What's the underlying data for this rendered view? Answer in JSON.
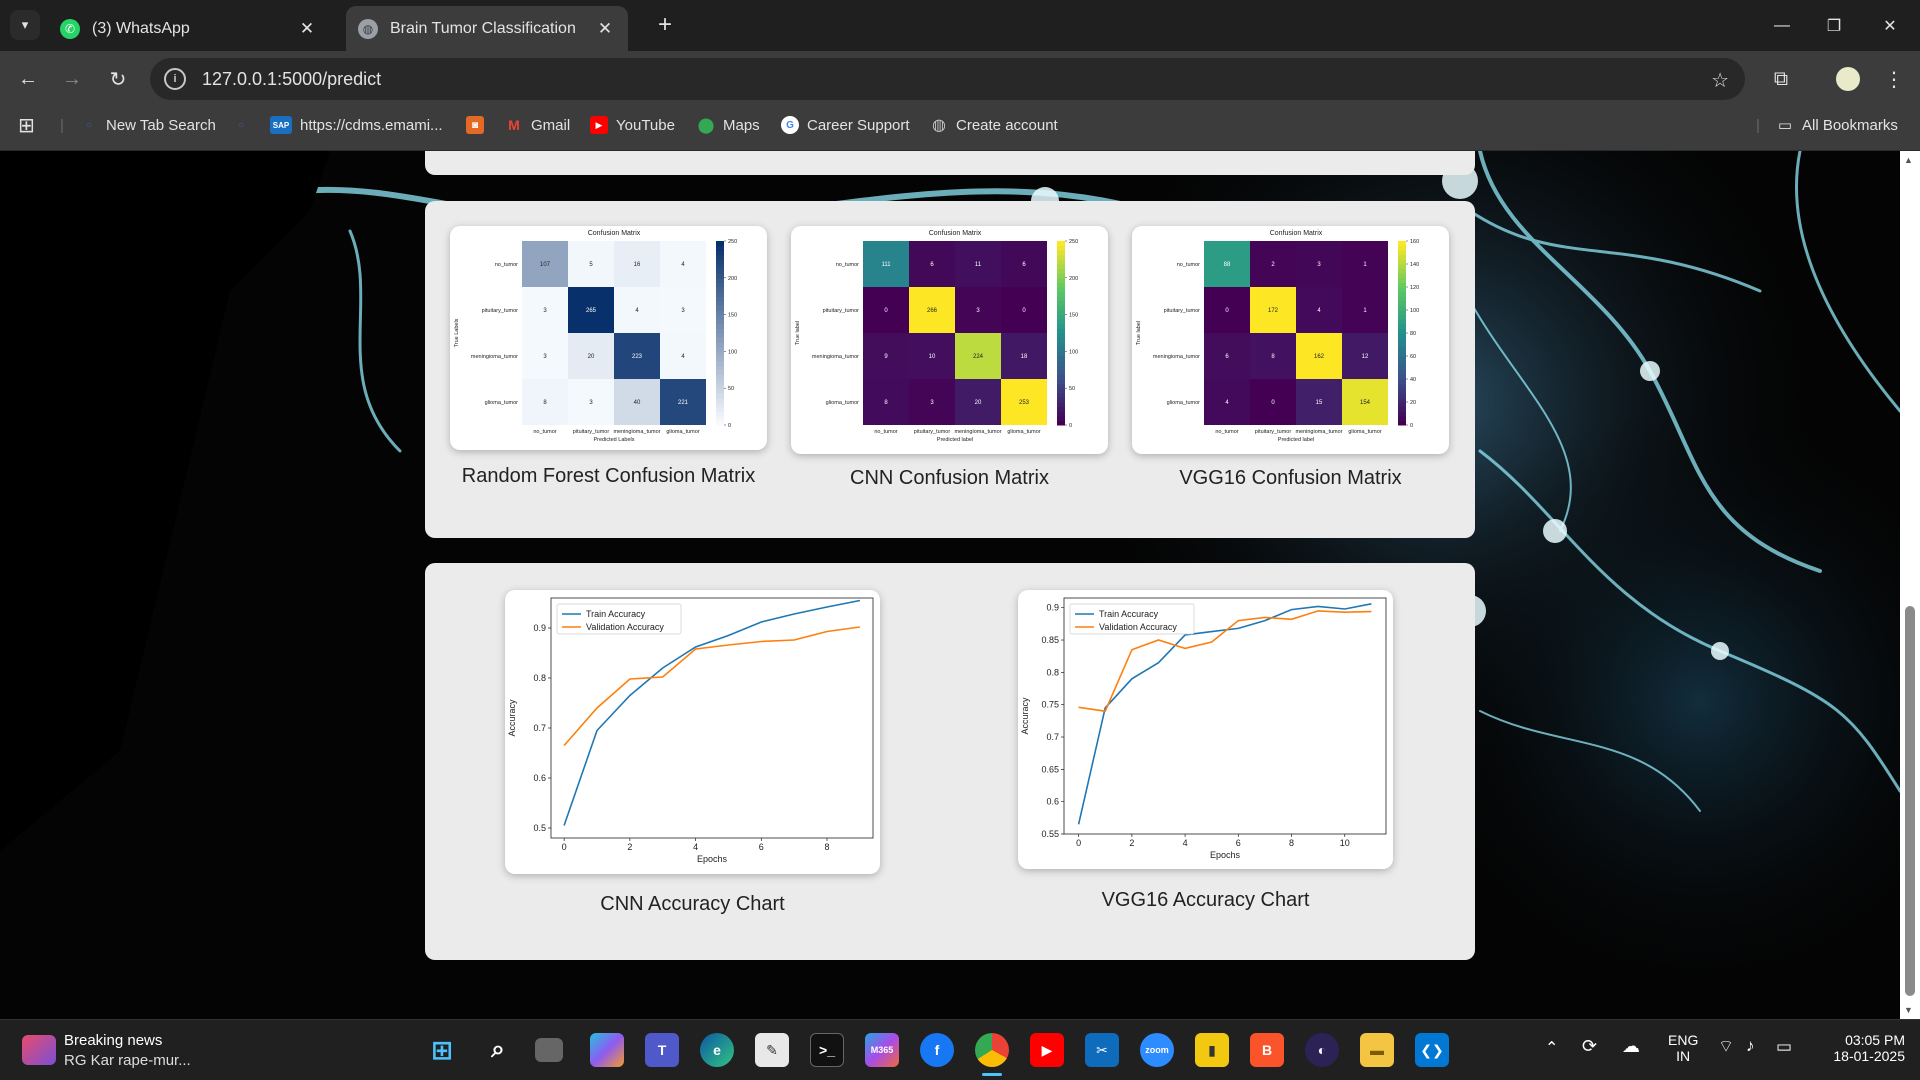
{
  "browser": {
    "tabs": [
      {
        "title": "(3) WhatsApp",
        "active": false,
        "icon": "whatsapp-icon"
      },
      {
        "title": "Brain Tumor Classification",
        "active": true,
        "icon": "globe-icon"
      }
    ],
    "url": "127.0.0.1:5000/predict",
    "bookmarks": [
      {
        "label": "New Tab Search",
        "icon": "search-icon"
      },
      {
        "label": "https://cdms.emami...",
        "icon": "sap-icon"
      },
      {
        "label": "",
        "icon": "bookmark-app-icon"
      },
      {
        "label": "Gmail",
        "icon": "gmail-icon"
      },
      {
        "label": "YouTube",
        "icon": "youtube-icon"
      },
      {
        "label": "Maps",
        "icon": "maps-icon"
      },
      {
        "label": "Career Support",
        "icon": "google-icon"
      },
      {
        "label": "Create account",
        "icon": "globe-icon"
      }
    ],
    "all_bookmarks": "All Bookmarks"
  },
  "page": {
    "confusion_captions": [
      "Random Forest Confusion Matrix",
      "CNN Confusion Matrix",
      "VGG16 Confusion Matrix"
    ],
    "accuracy_captions": [
      "CNN Accuracy Chart",
      "VGG16 Accuracy Chart"
    ]
  },
  "chart_data": [
    {
      "type": "heatmap",
      "title": "Confusion Matrix",
      "xlabel": "Predicted Labels",
      "ylabel": "True Labels",
      "labels": [
        "no_tumor",
        "pituitary_tumor",
        "meningioma_tumor",
        "glioma_tumor"
      ],
      "matrix": [
        [
          107,
          5,
          16,
          4
        ],
        [
          3,
          265,
          4,
          3
        ],
        [
          3,
          20,
          223,
          4
        ],
        [
          8,
          3,
          40,
          221
        ]
      ],
      "colorbar_ticks": [
        0,
        50,
        100,
        150,
        200,
        250
      ],
      "colormap": "Blues"
    },
    {
      "type": "heatmap",
      "title": "Confusion Matrix",
      "xlabel": "Predicted label",
      "ylabel": "True label",
      "labels": [
        "no_tumor",
        "pituitary_tumor",
        "meningioma_tumor",
        "glioma_tumor"
      ],
      "matrix": [
        [
          111,
          6,
          11,
          6
        ],
        [
          0,
          266,
          3,
          0
        ],
        [
          9,
          10,
          224,
          18
        ],
        [
          8,
          3,
          20,
          253
        ]
      ],
      "colorbar_ticks": [
        0,
        50,
        100,
        150,
        200,
        250
      ],
      "colormap": "viridis"
    },
    {
      "type": "heatmap",
      "title": "Confusion Matrix",
      "xlabel": "Predicted label",
      "ylabel": "True label",
      "labels": [
        "no_tumor",
        "pituitary_tumor",
        "meningioma_tumor",
        "glioma_tumor"
      ],
      "matrix": [
        [
          88,
          2,
          3,
          1
        ],
        [
          0,
          172,
          4,
          1
        ],
        [
          6,
          8,
          162,
          12
        ],
        [
          4,
          0,
          15,
          154
        ]
      ],
      "colorbar_ticks": [
        0,
        20,
        40,
        60,
        80,
        100,
        120,
        140,
        160
      ],
      "colormap": "viridis"
    },
    {
      "type": "line",
      "xlabel": "Epochs",
      "ylabel": "Accuracy",
      "xlim": [
        -0.4,
        9.4
      ],
      "ylim": [
        0.48,
        0.96
      ],
      "xticks": [
        0,
        2,
        4,
        6,
        8
      ],
      "yticks": [
        0.5,
        0.6,
        0.7,
        0.8,
        0.9
      ],
      "legend": "top-left",
      "series": [
        {
          "name": "Train Accuracy",
          "color": "#1f77b4",
          "x": [
            0,
            1,
            2,
            3,
            4,
            5,
            6,
            7,
            8,
            9
          ],
          "y": [
            0.505,
            0.695,
            0.765,
            0.82,
            0.862,
            0.885,
            0.912,
            0.928,
            0.942,
            0.955
          ]
        },
        {
          "name": "Validation Accuracy",
          "color": "#ff7f0e",
          "x": [
            0,
            1,
            2,
            3,
            4,
            5,
            6,
            7,
            8,
            9
          ],
          "y": [
            0.665,
            0.74,
            0.798,
            0.802,
            0.858,
            0.866,
            0.873,
            0.876,
            0.893,
            0.902
          ]
        }
      ]
    },
    {
      "type": "line",
      "xlabel": "Epochs",
      "ylabel": "Accuracy",
      "xlim": [
        -0.55,
        11.55
      ],
      "ylim": [
        0.55,
        0.915
      ],
      "xticks": [
        0,
        2,
        4,
        6,
        8,
        10
      ],
      "yticks": [
        0.55,
        0.6,
        0.65,
        0.7,
        0.75,
        0.8,
        0.85,
        0.9
      ],
      "legend": "top-left",
      "series": [
        {
          "name": "Train Accuracy",
          "color": "#1f77b4",
          "x": [
            0,
            1,
            2,
            3,
            4,
            5,
            6,
            7,
            8,
            9,
            10,
            11
          ],
          "y": [
            0.565,
            0.745,
            0.79,
            0.815,
            0.858,
            0.863,
            0.868,
            0.88,
            0.897,
            0.902,
            0.898,
            0.906
          ]
        },
        {
          "name": "Validation Accuracy",
          "color": "#ff7f0e",
          "x": [
            0,
            1,
            2,
            3,
            4,
            5,
            6,
            7,
            8,
            9,
            10,
            11
          ],
          "y": [
            0.746,
            0.74,
            0.835,
            0.85,
            0.837,
            0.847,
            0.88,
            0.885,
            0.882,
            0.895,
            0.893,
            0.894
          ]
        }
      ]
    }
  ],
  "taskbar": {
    "news_title": "Breaking news",
    "news_sub": "RG Kar rape-mur...",
    "lang": "ENG",
    "region": "IN",
    "time": "03:05 PM",
    "date": "18-01-2025"
  }
}
